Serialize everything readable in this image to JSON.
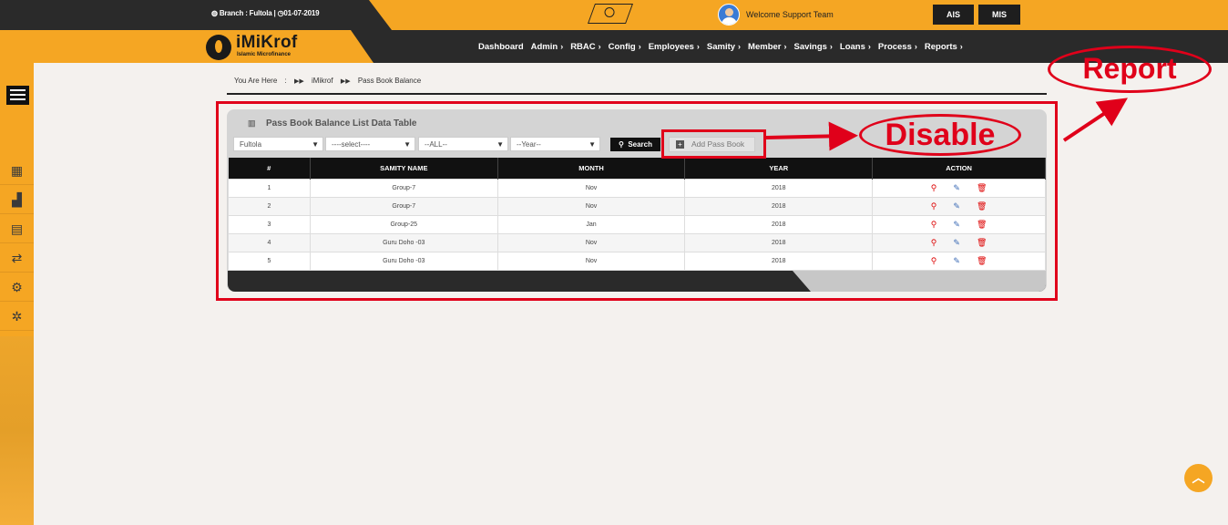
{
  "topbar": {
    "branch_label": "Branch : Fultola |",
    "date": "01-07-2019",
    "welcome": "Welcome Support Team",
    "buttons": [
      "AIS",
      "MIS"
    ]
  },
  "logo": {
    "name": "iMiKrof",
    "tagline": "Islamic Microfinance"
  },
  "menu": [
    "Dashboard",
    "Admin",
    "RBAC",
    "Config",
    "Employees",
    "Samity",
    "Member",
    "Savings",
    "Loans",
    "Process",
    "Reports"
  ],
  "breadcrumb": {
    "prefix": "You Are Here",
    "sep": ":",
    "items": [
      "iMikrof",
      "Pass Book Balance"
    ]
  },
  "panel": {
    "title": "Pass Book Balance List Data Table",
    "filters": [
      "Fultola",
      "----select----",
      "--ALL--",
      "--Year--"
    ],
    "search_label": "Search",
    "add_label": "Add Pass Book"
  },
  "table": {
    "headers": [
      "#",
      "SAMITY NAME",
      "MONTH",
      "YEAR",
      "ACTION"
    ],
    "rows": [
      [
        "1",
        "Group-7",
        "Nov",
        "2018"
      ],
      [
        "2",
        "Group-7",
        "Nov",
        "2018"
      ],
      [
        "3",
        "Group-25",
        "Jan",
        "2018"
      ],
      [
        "4",
        "Guru Doho -03",
        "Nov",
        "2018"
      ],
      [
        "5",
        "Guru Doho -03",
        "Nov",
        "2018"
      ]
    ]
  },
  "annotations": {
    "disable": "Disable",
    "report": "Report"
  },
  "colors": {
    "brand": "#f5a623",
    "dark": "#2a2a2a",
    "annotation": "#e0001a"
  }
}
